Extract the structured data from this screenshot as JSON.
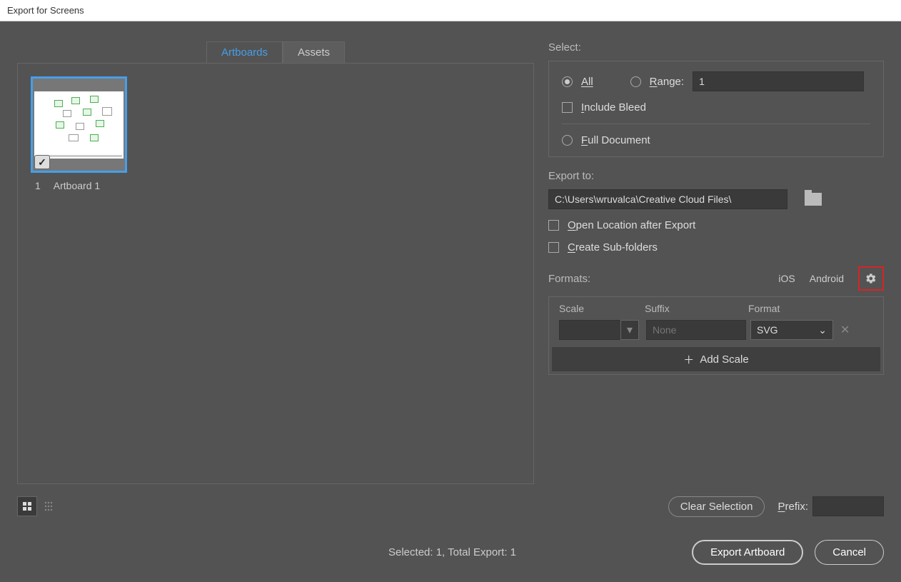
{
  "window": {
    "title": "Export for Screens"
  },
  "tabs": {
    "artboards": "Artboards",
    "assets": "Assets"
  },
  "artboard": {
    "index": "1",
    "name": "Artboard 1"
  },
  "select": {
    "label": "Select:",
    "all": "All",
    "range": "Range:",
    "range_value": "1",
    "include_bleed": "Include Bleed",
    "full_document": "Full Document"
  },
  "export_to": {
    "label": "Export to:",
    "path": "C:\\Users\\wruvalca\\Creative Cloud Files\\",
    "open_location": "Open Location after Export",
    "create_subfolders": "Create Sub-folders"
  },
  "formats": {
    "label": "Formats:",
    "ios": "iOS",
    "android": "Android",
    "col_scale": "Scale",
    "col_suffix": "Suffix",
    "col_format": "Format",
    "row": {
      "scale": "",
      "suffix_placeholder": "None",
      "format": "SVG"
    },
    "add_scale": "Add Scale"
  },
  "footer": {
    "clear": "Clear Selection",
    "prefix_label": "Prefix:",
    "prefix_value": "",
    "status": "Selected: 1, Total Export: 1",
    "export_btn": "Export Artboard",
    "cancel_btn": "Cancel"
  }
}
